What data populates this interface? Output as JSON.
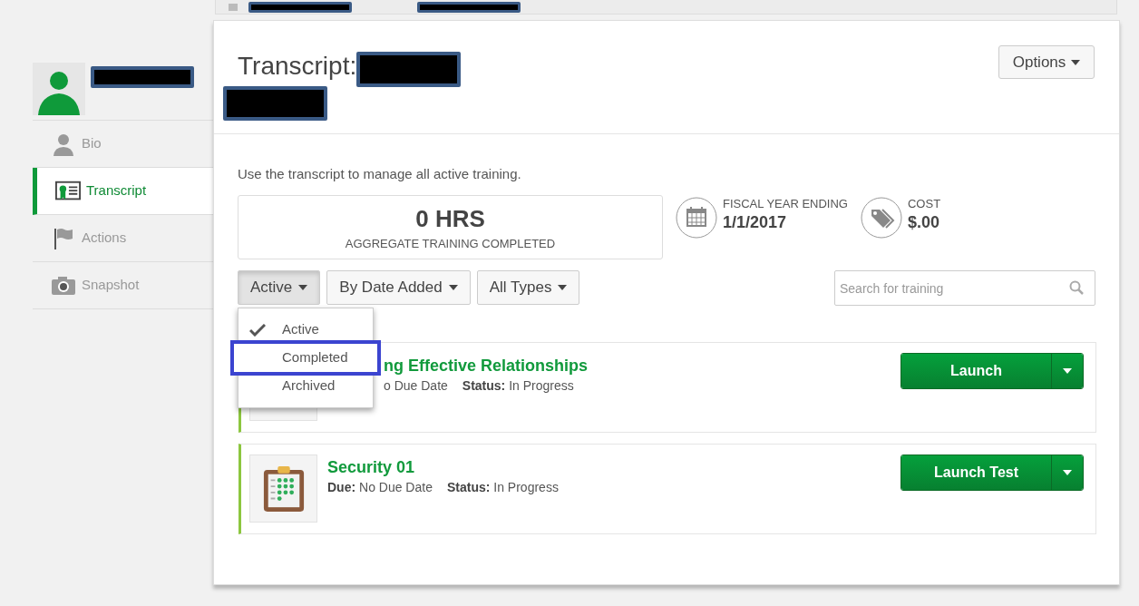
{
  "sidebar": {
    "items": [
      {
        "label": "Bio",
        "kind": "person",
        "selected": false
      },
      {
        "label": "Transcript",
        "kind": "certificate",
        "selected": true
      },
      {
        "label": "Actions",
        "kind": "flag",
        "selected": false
      },
      {
        "label": "Snapshot",
        "kind": "camera",
        "selected": false
      }
    ]
  },
  "header": {
    "title": "Transcript:",
    "options_button": "Options"
  },
  "description": "Use the transcript to manage all active training.",
  "stats": {
    "hours": "0 HRS",
    "hours_label": "AGGREGATE TRAINING COMPLETED",
    "fiscal_label": "FISCAL YEAR ENDING",
    "fiscal_value": "1/1/2017",
    "cost_label": "COST",
    "cost_value": "$.00"
  },
  "filters": [
    {
      "label": "Active",
      "expanded": true
    },
    {
      "label": "By Date Added",
      "expanded": false
    },
    {
      "label": "All Types",
      "expanded": false
    }
  ],
  "status_menu": {
    "items": [
      {
        "label": "Active",
        "checked": true,
        "highlighted": false
      },
      {
        "label": "Completed",
        "checked": false,
        "highlighted": true
      },
      {
        "label": "Archived",
        "checked": false,
        "highlighted": false
      }
    ]
  },
  "search": {
    "placeholder": "Search for training"
  },
  "trainings": [
    {
      "title": "ng Effective Relationships",
      "due_value": "o Due Date",
      "status_label": "Status:",
      "status_value": "In Progress",
      "action": "Launch",
      "has_icon": false
    },
    {
      "title": "Security 01",
      "due_label": "Due:",
      "due_value": "No Due Date",
      "status_label": "Status:",
      "status_value": "In Progress",
      "action": "Launch Test",
      "has_icon": true
    }
  ]
}
